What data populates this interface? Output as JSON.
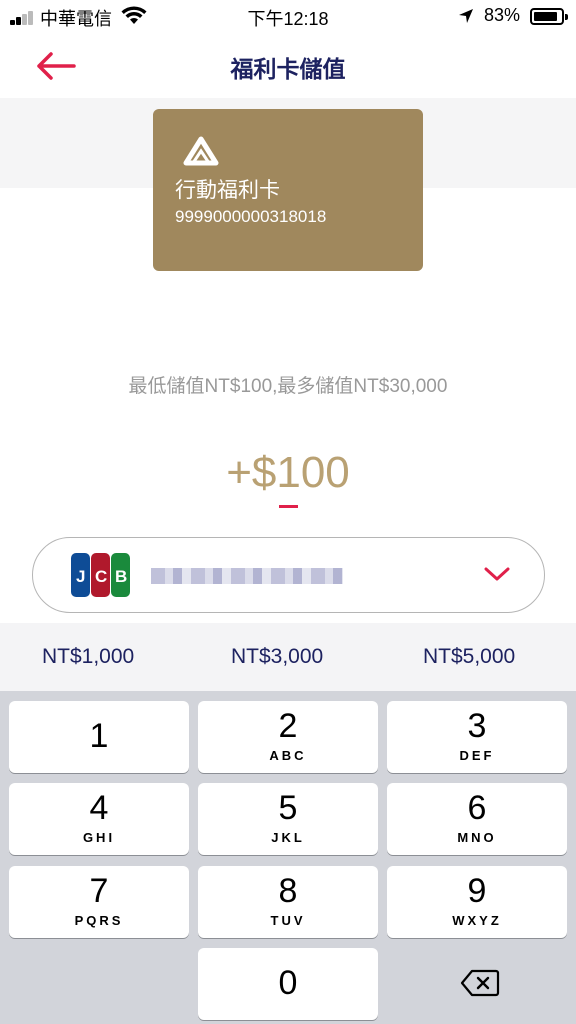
{
  "status": {
    "carrier": "中華電信",
    "time": "下午12:18",
    "battery": "83%"
  },
  "header": {
    "title": "福利卡儲值",
    "back_icon": "arrow-left-icon"
  },
  "card": {
    "name": "行動福利卡",
    "number": "9999000000318018",
    "color": "#a0885d"
  },
  "topup": {
    "limit_text": "最低儲值NT$100,最多儲值NT$30,000",
    "amount": "+$100"
  },
  "payment": {
    "brand_icon": "jcb-card-icon",
    "dropdown_icon": "chevron-down-icon"
  },
  "quick_amounts": [
    "NT$1,000",
    "NT$3,000",
    "NT$5,000"
  ],
  "keypad": {
    "keys": [
      {
        "num": "1",
        "letters": ""
      },
      {
        "num": "2",
        "letters": "ABC"
      },
      {
        "num": "3",
        "letters": "DEF"
      },
      {
        "num": "4",
        "letters": "GHI"
      },
      {
        "num": "5",
        "letters": "JKL"
      },
      {
        "num": "6",
        "letters": "MNO"
      },
      {
        "num": "7",
        "letters": "PQRS"
      },
      {
        "num": "8",
        "letters": "TUV"
      },
      {
        "num": "9",
        "letters": "WXYZ"
      },
      {
        "num": "0",
        "letters": ""
      }
    ],
    "delete_icon": "backspace-icon"
  },
  "colors": {
    "accent_red": "#e0204a",
    "navy": "#1d2260",
    "gold": "#b9a173"
  }
}
